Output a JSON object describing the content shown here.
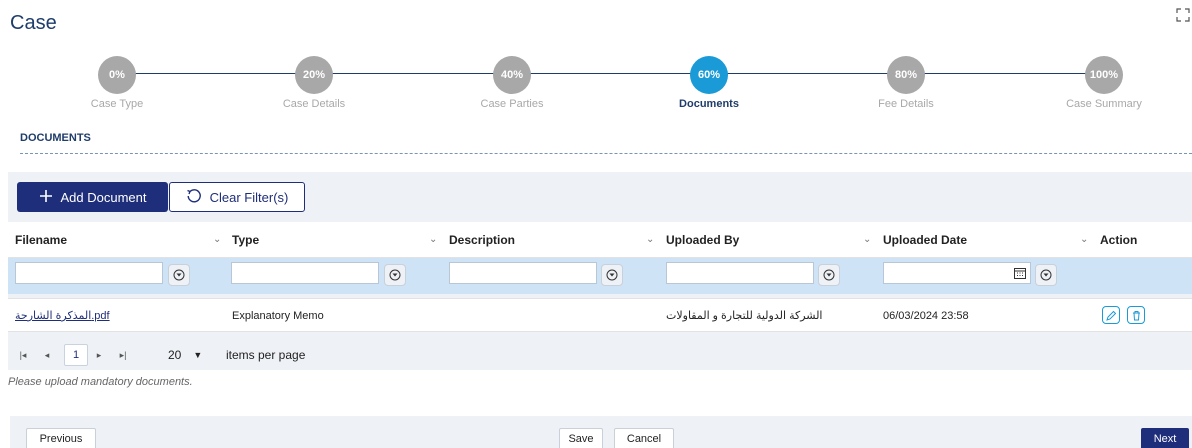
{
  "page": {
    "title": "Case"
  },
  "stepper": {
    "steps": [
      {
        "percent": "0%",
        "label": "Case Type",
        "active": false
      },
      {
        "percent": "20%",
        "label": "Case Details",
        "active": false
      },
      {
        "percent": "40%",
        "label": "Case Parties",
        "active": false
      },
      {
        "percent": "60%",
        "label": "Documents",
        "active": true
      },
      {
        "percent": "80%",
        "label": "Fee Details",
        "active": false
      },
      {
        "percent": "100%",
        "label": "Case Summary",
        "active": false
      }
    ]
  },
  "section": {
    "title": "DOCUMENTS"
  },
  "toolbar": {
    "add_label": "Add Document",
    "clear_label": "Clear Filter(s)"
  },
  "table": {
    "columns": [
      "Filename",
      "Type",
      "Description",
      "Uploaded By",
      "Uploaded Date",
      "Action"
    ],
    "rows": [
      {
        "filename": "المذكرة الشارحة.pdf",
        "type": "Explanatory Memo",
        "description": "",
        "uploaded_by": "الشركة الدولية للتجارة و المقاولات",
        "uploaded_date": "06/03/2024 23:58"
      }
    ]
  },
  "pager": {
    "current_page": "1",
    "page_size": "20",
    "items_per_page_label": "items per page"
  },
  "note": "Please upload mandatory documents.",
  "footer": {
    "previous_label": "Previous",
    "save_label": "Save",
    "cancel_label": "Cancel",
    "next_label": "Next"
  },
  "colors": {
    "primary": "#1f2e7a",
    "accent": "#1a9ad6",
    "filter_bg": "#cfe3f7",
    "inactive": "#a8a8a8"
  }
}
